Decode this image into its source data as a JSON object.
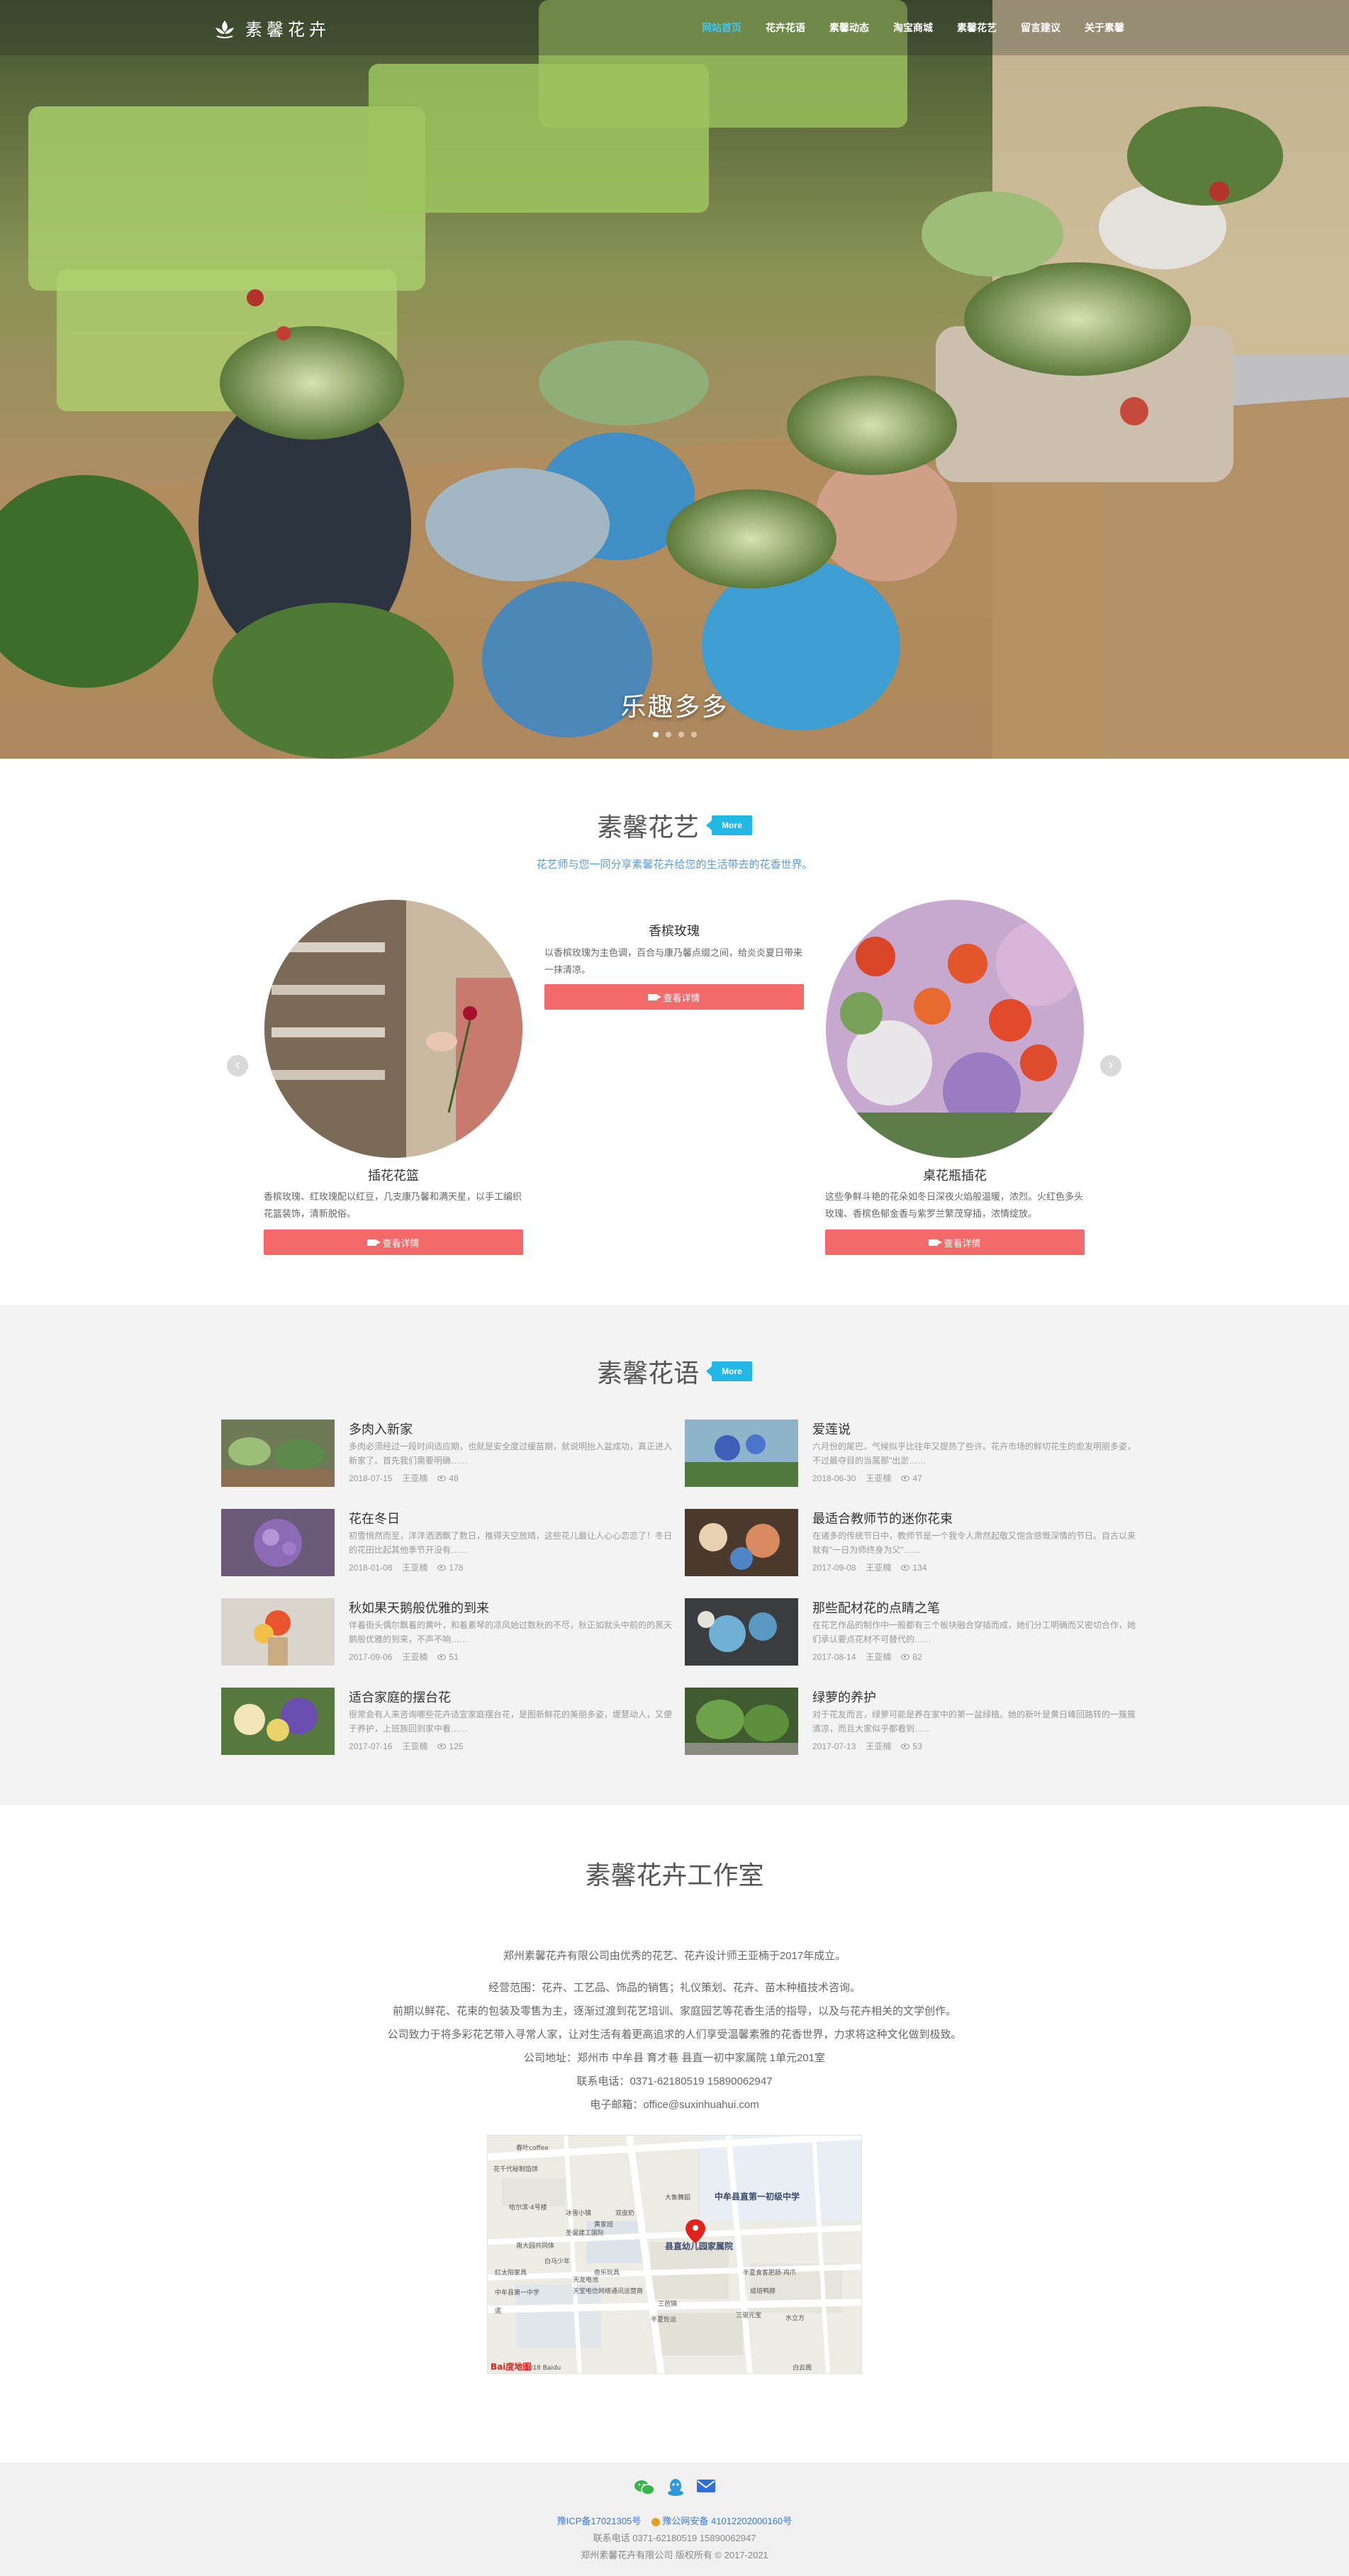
{
  "nav": {
    "logo_text": "素馨花卉",
    "menu": [
      "网站首页",
      "花卉花语",
      "素馨动态",
      "淘宝商城",
      "素馨花艺",
      "留言建议",
      "关于素馨"
    ]
  },
  "hero": {
    "caption": "乐趣多多",
    "slide_count": 4,
    "active_slide": 1
  },
  "flower_art": {
    "title": "素馨花艺",
    "more": "More",
    "subtitle": "花艺师与您一同分享素馨花卉给您的生活带去的花香世界。",
    "cards": [
      {
        "title": "插花花篮",
        "text": "香槟玫瑰、红玫瑰配以红豆，几支康乃馨和满天星，以手工编织花篮装饰，清新脱俗。",
        "button": "查看详情"
      },
      {
        "title": "香槟玫瑰",
        "text": "以香槟玫瑰为主色调，百合与康乃馨点缀之间，给炎炎夏日带来一抹清凉。",
        "button": "查看详情"
      },
      {
        "title": "桌花瓶插花",
        "text": "这些争鲜斗艳的花朵如冬日深夜火焰般温暖，浓烈。火红色多头玫瑰、香槟色郁金香与紫罗兰繁茂穿插，浓情绽放。",
        "button": "查看详情"
      }
    ],
    "prev": "‹",
    "next": "›"
  },
  "flower_language": {
    "title": "素馨花语",
    "more": "More",
    "posts": [
      {
        "title": "多肉入新家",
        "desc": "多肉必须经过一段时间适应期，也就是安全度过缓苗期，就说明抬入盆成功，真正进入新家了。首先我们需要明确……",
        "date": "2018-07-15",
        "author": "王亚楠",
        "views": "48"
      },
      {
        "title": "爱莲说",
        "desc": "六月份的尾巴，气候似乎比往年又提热了些许。花卉市场的鲜切花生的愈发明丽多姿，不过最夺目的当属那\"出淤……",
        "date": "2018-06-30",
        "author": "王亚楠",
        "views": "47"
      },
      {
        "title": "花在冬日",
        "desc": "初雪悄然而至，洋洋洒洒飘了数日，推得天空放晴，这些花儿最让人心心恋恋了！冬日的花田比起其他季节开没有……",
        "date": "2018-01-08",
        "author": "王亚楠",
        "views": "178"
      },
      {
        "title": "最适合教师节的迷你花束",
        "desc": "在诸多的传统节日中，教师节是一个我令人肃然起敬又饱含感慨深情的节日。自古以来就有\"一日为师终身为父\"……",
        "date": "2017-09-08",
        "author": "王亚楠",
        "views": "134"
      },
      {
        "title": "秋如果天鹅般优雅的到来",
        "desc": "伴着街头偶尔飘着的黄叶，和着素琴的凉风始过数秋的不尽，秋正如就头中前的的黑天鹅般优雅的到来，不声不响……",
        "date": "2017-09-06",
        "author": "王亚楠",
        "views": "51"
      },
      {
        "title": "那些配材花的点睛之笔",
        "desc": "在花艺作品的制作中一般都有三个板块融合穿插而成，她们分工明确而又密切合作，她们承认要点花材不可替代的……",
        "date": "2017-08-14",
        "author": "王亚楠",
        "views": "82"
      },
      {
        "title": "适合家庭的摆台花",
        "desc": "很常会有人来咨询哪些花卉适宜家庭摆台花，是图新鲜花的美丽多姿，堤慧动人，又便于养护，上班族回到家中看……",
        "date": "2017-07-16",
        "author": "王亚楠",
        "views": "125"
      },
      {
        "title": "绿萝的养护",
        "desc": "对于花友而言，绿萝可能是养在家中的第一盆绿植。她的新叶是黄日峰回路转的一簇簇清凉，而且大家似乎都看到……",
        "date": "2017-07-13",
        "author": "王亚楠",
        "views": "53"
      }
    ]
  },
  "studio": {
    "title": "素馨花卉工作室",
    "intro": "郑州素馨花卉有限公司由优秀的花艺、花卉设计师王亚楠于2017年成立。",
    "scope": "经营范围：花卉、工艺品、饰品的销售；礼仪策划、花卉、苗木种植技术咨询。",
    "line2": "前期以鲜花、花束的包装及零售为主，逐渐过渡到花艺培训、家庭园艺等花香生活的指导，以及与花卉相关的文学创作。",
    "line3": "公司致力于将多彩花艺带入寻常人家，让对生活有着更高追求的人们享受温馨素雅的花香世界，力求将这种文化做到极致。",
    "address": "公司地址：郑州市 中牟县 育才巷 县直一初中家属院 1单元201室",
    "phone": "联系电话：0371-62180519  15890062947",
    "email": "电子邮箱：office@suxinhuahui.com"
  },
  "map": {
    "labels": [
      "春叶coffee",
      "花千代秘制馅饼",
      "大象舞蹈",
      "冰雪小镇",
      "双皮奶",
      "黄家班",
      "哈尔滨·4号楼",
      "圣诞建工国际",
      "南大园共同体",
      "中牟县直第一初级中学",
      "县直幼儿园家属院",
      "白马少年",
      "天龙电池",
      "半夏食客肥肠·鸡爪",
      "天堂电信网络通讯运营商",
      "奇乐玩具",
      "三邑锦",
      "成培鸭脖",
      "三驱元宝",
      "水立方",
      "红太阳家具",
      "中牟县第一中学",
      "半夏佐运",
      "诺",
      "白云阁",
      "© 2018 Baidu",
      "Bai度地图"
    ]
  },
  "footer": {
    "icp": "豫ICP备17021305号",
    "police": "豫公网安备 41012202000160号",
    "phone": "联系电话 0371-62180519  15890062947",
    "copyright": "郑州素馨花卉有限公司 版权所有 © 2017-2021"
  },
  "colors": {
    "accent_blue": "#23b7e5",
    "nav_active": "#3fc5ef",
    "button_red": "#f46969",
    "section_grey": "#f3f3f3"
  }
}
